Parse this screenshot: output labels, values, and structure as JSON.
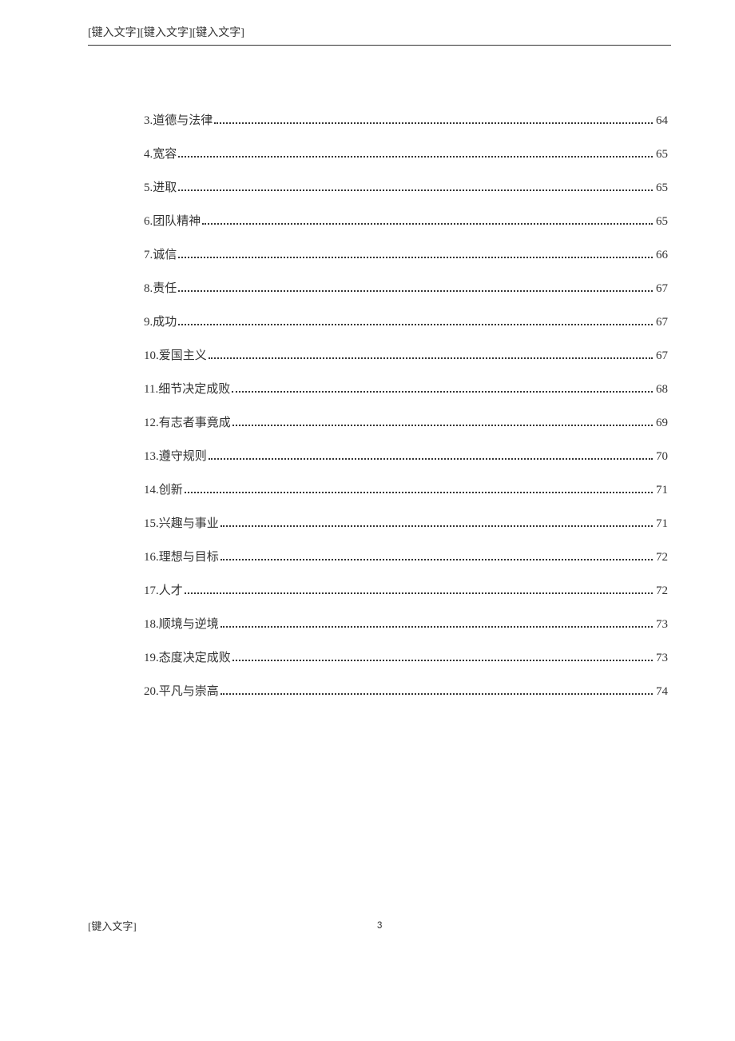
{
  "header": {
    "placeholder_text": "[键入文字][键入文字][键入文字]"
  },
  "toc": {
    "entries": [
      {
        "title": "3.道德与法律",
        "page": "64"
      },
      {
        "title": "4.宽容",
        "page": "65"
      },
      {
        "title": "5.进取",
        "page": "65"
      },
      {
        "title": "6.团队精神",
        "page": "65"
      },
      {
        "title": "7.诚信",
        "page": "66"
      },
      {
        "title": "8.责任",
        "page": "67"
      },
      {
        "title": "9.成功",
        "page": "67"
      },
      {
        "title": "10.爱国主义",
        "page": "67"
      },
      {
        "title": "11.细节决定成败",
        "page": "68"
      },
      {
        "title": "12.有志者事竟成",
        "page": "69"
      },
      {
        "title": "13.遵守规则",
        "page": "70"
      },
      {
        "title": "14.创新",
        "page": "71"
      },
      {
        "title": "15.兴趣与事业",
        "page": "71"
      },
      {
        "title": "16.理想与目标",
        "page": "72"
      },
      {
        "title": "17.人才",
        "page": "72"
      },
      {
        "title": "18.顺境与逆境",
        "page": "73"
      },
      {
        "title": "19.态度决定成败",
        "page": "73"
      },
      {
        "title": "20.平凡与崇高",
        "page": "74"
      }
    ]
  },
  "footer": {
    "placeholder_text": "[键入文字]",
    "page_number": "3"
  }
}
